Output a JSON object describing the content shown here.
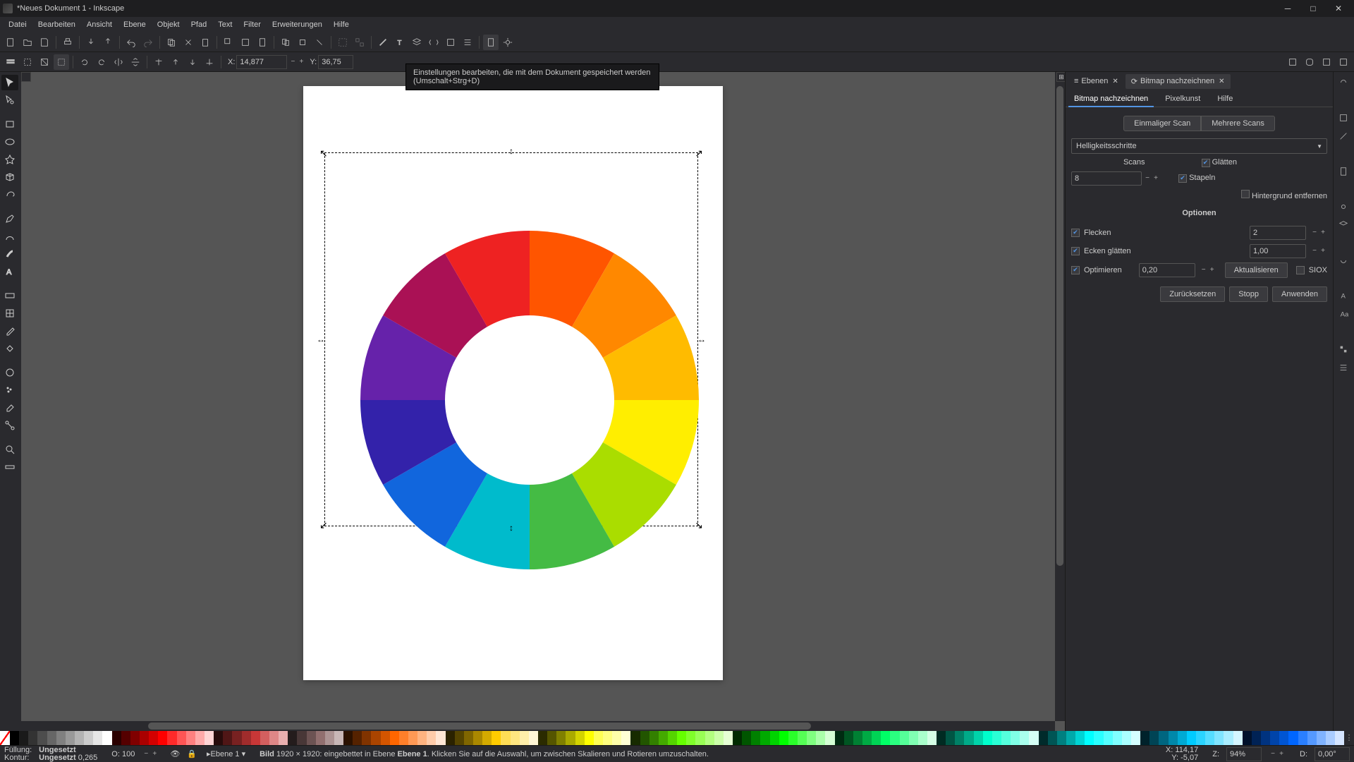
{
  "title": "*Neues Dokument 1 - Inkscape",
  "menu": [
    "Datei",
    "Bearbeiten",
    "Ansicht",
    "Ebene",
    "Objekt",
    "Pfad",
    "Text",
    "Filter",
    "Erweiterungen",
    "Hilfe"
  ],
  "tooltip": "Einstellungen bearbeiten, die mit dem Dokument gespeichert werden (Umschalt+Strg+D)",
  "toolbar2": {
    "x_label": "X:",
    "x_val": "14,877",
    "y_label": "Y:",
    "y_val": "36,75"
  },
  "panel": {
    "tabs": {
      "layers": "Ebenen",
      "trace": "Bitmap nachzeichnen"
    },
    "subtabs": {
      "trace": "Bitmap nachzeichnen",
      "pixelart": "Pixelkunst",
      "help": "Hilfe"
    },
    "scan_toggle": {
      "single": "Einmaliger Scan",
      "multi": "Mehrere Scans"
    },
    "mode": "Helligkeitsschritte",
    "scans_label": "Scans",
    "scans_value": "8",
    "smooth": "Glätten",
    "stack": "Stapeln",
    "removebg": "Hintergrund entfernen",
    "options": "Optionen",
    "speckles": "Flecken",
    "speckles_val": "2",
    "corners": "Ecken glätten",
    "corners_val": "1,00",
    "optimize": "Optimieren",
    "optimize_val": "0,20",
    "update": "Aktualisieren",
    "siox": "SIOX",
    "reset": "Zurücksetzen",
    "stop": "Stopp",
    "apply": "Anwenden"
  },
  "status": {
    "fill_label": "Füllung:",
    "fill_val": "Ungesetzt",
    "stroke_label": "Kontur:",
    "stroke_val": "Ungesetzt",
    "stroke_w": "0,265",
    "opacity_label": "O:",
    "opacity_val": "100",
    "layer": "▸Ebene 1 ▾",
    "info_pre": "Bild",
    "info_dims": "1920 × 1920: eingebettet in Ebene",
    "info_bold": "Ebene 1",
    "info_post": ". Klicken Sie auf die Auswahl, um zwischen Skalieren und Rotieren umzuschalten.",
    "coord_x": "X:",
    "coord_x_val": "114,17",
    "coord_y": "Y:",
    "coord_y_val": "-5,07",
    "zoom_label": "Z:",
    "zoom_val": "94%",
    "rot_label": "D:",
    "rot_val": "0,00°"
  },
  "palette_colors": [
    "#000000",
    "#1a1a1a",
    "#333333",
    "#4d4d4d",
    "#666666",
    "#808080",
    "#999999",
    "#b3b3b3",
    "#cccccc",
    "#e6e6e6",
    "#ffffff",
    "#2b0000",
    "#550000",
    "#800000",
    "#aa0000",
    "#d40000",
    "#ff0000",
    "#ff2a2a",
    "#ff5555",
    "#ff8080",
    "#ffaaaa",
    "#ffd5d5",
    "#280b0b",
    "#501616",
    "#782121",
    "#a02c2c",
    "#c83737",
    "#d35f5f",
    "#de8787",
    "#e9afaf",
    "#241c1c",
    "#483737",
    "#6c5353",
    "#916f6f",
    "#ac9393",
    "#c8b7b7",
    "#2b1100",
    "#552200",
    "#803300",
    "#aa4400",
    "#d45500",
    "#ff6600",
    "#ff7f2a",
    "#ff9955",
    "#ffb380",
    "#ffccaa",
    "#ffe6d5",
    "#2b2200",
    "#554400",
    "#806600",
    "#aa8800",
    "#d4aa00",
    "#ffcc00",
    "#ffdd55",
    "#ffe680",
    "#ffeeaa",
    "#fff6d5",
    "#2b2b00",
    "#555500",
    "#808000",
    "#aaaa00",
    "#d4d400",
    "#ffff00",
    "#ffff55",
    "#ffff80",
    "#ffffaa",
    "#ffffd5",
    "#172b00",
    "#225500",
    "#338000",
    "#44aa00",
    "#55d400",
    "#66ff00",
    "#80ff2a",
    "#99ff55",
    "#b3ff80",
    "#ccffaa",
    "#e6ffd5",
    "#002b00",
    "#005500",
    "#008000",
    "#00aa00",
    "#00d400",
    "#00ff00",
    "#2aff2a",
    "#55ff55",
    "#80ff80",
    "#aaffaa",
    "#d5ffd5",
    "#002b11",
    "#005522",
    "#008033",
    "#00aa44",
    "#00d455",
    "#00ff66",
    "#2aff80",
    "#55ff99",
    "#80ffb3",
    "#aaffcc",
    "#d5ffe6",
    "#002b22",
    "#005544",
    "#008066",
    "#00aa88",
    "#00d4aa",
    "#00ffcc",
    "#2affd5",
    "#55ffdd",
    "#80ffe6",
    "#aaffee",
    "#d5fff6",
    "#002b2b",
    "#005555",
    "#008080",
    "#00aaaa",
    "#00d4d4",
    "#00ffff",
    "#2affff",
    "#55ffff",
    "#80ffff",
    "#aaffff",
    "#d5ffff",
    "#00222b",
    "#004455",
    "#006680",
    "#0088aa",
    "#00aad4",
    "#00ccff",
    "#2ad4ff",
    "#55ddff",
    "#80e5ff",
    "#aaeeff",
    "#d5f6ff",
    "#00112b",
    "#002255",
    "#003380",
    "#0044aa",
    "#0055d4",
    "#0066ff",
    "#2a7fff",
    "#5599ff",
    "#80b3ff",
    "#aaccff",
    "#d5e5ff"
  ]
}
